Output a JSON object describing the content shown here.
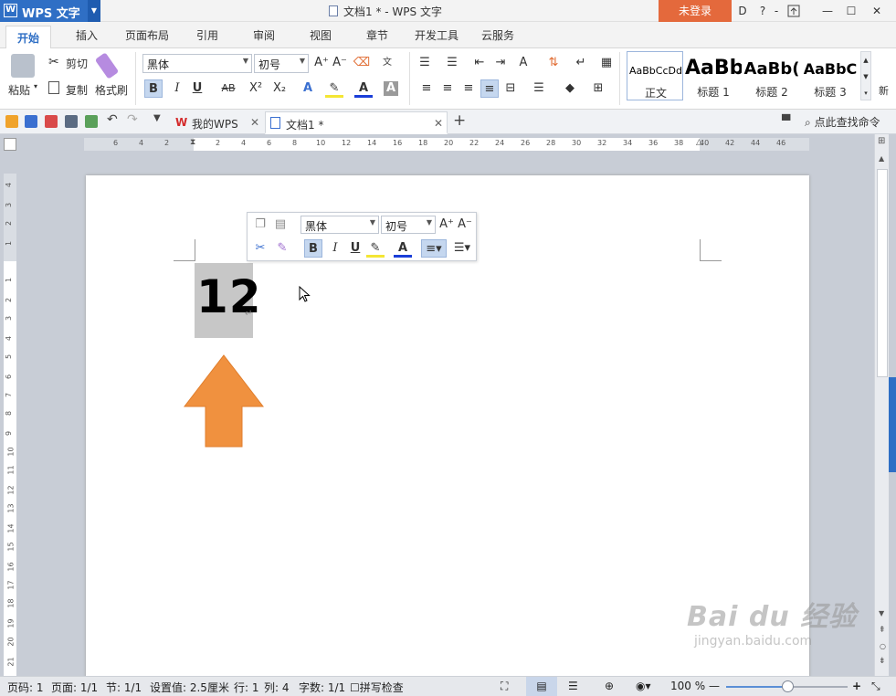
{
  "app": {
    "name": "WPS 文字",
    "logo_letter": "W",
    "window_title": "文档1 * - WPS 文字",
    "login": "未登录"
  },
  "window_controls": {
    "skin": "D",
    "help": "?",
    "more": "-",
    "restore": "⇱",
    "minimize": "—",
    "maximize": "☐",
    "close": "✕"
  },
  "tabs": [
    "开始",
    "插入",
    "页面布局",
    "引用",
    "审阅",
    "视图",
    "章节",
    "开发工具",
    "云服务"
  ],
  "ribbon": {
    "paste": "粘贴",
    "cut": "剪切",
    "copy": "复制",
    "format_painter": "格式刷",
    "font": "黑体",
    "size": "初号",
    "bold": "B",
    "italic": "I",
    "underline": "U",
    "strike": "AB",
    "sup": "X²",
    "sub": "X₂",
    "grow": "A⁺",
    "shrink": "A⁻",
    "styles": [
      {
        "sample": "AaBbCcDd",
        "label": "正文"
      },
      {
        "sample": "AaBb",
        "label": "标题 1"
      },
      {
        "sample": "AaBb(",
        "label": "标题 2"
      },
      {
        "sample": "AaBbC",
        "label": "标题 3"
      }
    ],
    "styles_more": "新"
  },
  "doc_tabs": {
    "home": "我的WPS",
    "doc": "文档1 *",
    "search": "点此查找命令"
  },
  "hruler_ticks": [
    "6",
    "4",
    "2",
    "2",
    "4",
    "6",
    "8",
    "10",
    "12",
    "14",
    "16",
    "18",
    "20",
    "22",
    "24",
    "26",
    "28",
    "30",
    "32",
    "34",
    "36",
    "38",
    "40",
    "42",
    "44",
    "46"
  ],
  "vruler_ticks": [
    "4",
    "3",
    "2",
    "1",
    "1",
    "2",
    "3",
    "4",
    "5",
    "6",
    "7",
    "8",
    "9",
    "10",
    "11",
    "12",
    "13",
    "14",
    "15",
    "16",
    "17",
    "18",
    "19",
    "20",
    "21"
  ],
  "document": {
    "text": "12",
    "para_mark": "↵"
  },
  "mini_toolbar": {
    "font": "黑体",
    "size": "初号",
    "bold": "B",
    "italic": "I",
    "underline": "U"
  },
  "status": {
    "page_num": "页码: 1",
    "page": "页面: 1/1",
    "section": "节: 1/1",
    "setting": "设置值: 2.5厘米",
    "line": "行: 1",
    "col": "列: 4",
    "words": "字数: 1/1",
    "spell": "拼写检查",
    "zoom": "100 %",
    "zoom_level": 0.5
  },
  "watermark": {
    "logo": "Bai du 经验",
    "url": "jingyan.baidu.com"
  },
  "colors": {
    "brand": "#2f6fc5",
    "login": "#e4693c",
    "arrow": "#f0913f",
    "selection": "#c7c7c7",
    "font_color": "#1a3ed8"
  }
}
